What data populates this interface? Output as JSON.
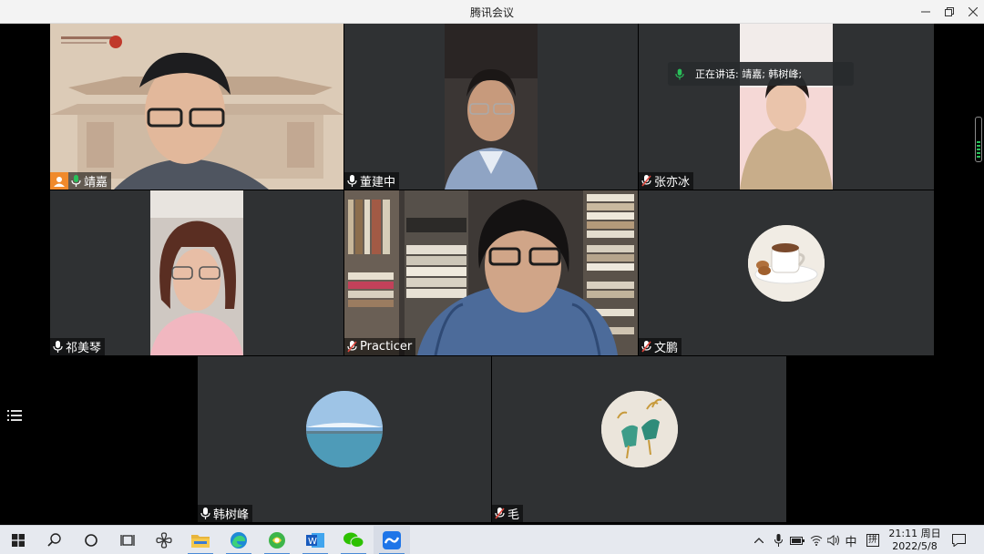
{
  "window": {
    "title": "腾讯会议"
  },
  "speaking_banner": {
    "text": "正在讲话: 靖嘉; 韩树峰;"
  },
  "participants": [
    {
      "name": "靖嘉"
    },
    {
      "name": "董建中"
    },
    {
      "name": "张亦冰"
    },
    {
      "name": "祁美琴"
    },
    {
      "name": "Practicer"
    },
    {
      "name": "文鹏"
    },
    {
      "name": "韩树峰"
    },
    {
      "name": "毛"
    }
  ],
  "taskbar": {
    "ime": "中",
    "ime_mode": "拼",
    "time": "21:11 周日",
    "date": "2022/5/8"
  },
  "colors": {
    "tile": "#2f3133",
    "accent": "#f08a2c",
    "mic_on": "#29c15a",
    "mic_off": "#e0463c"
  }
}
